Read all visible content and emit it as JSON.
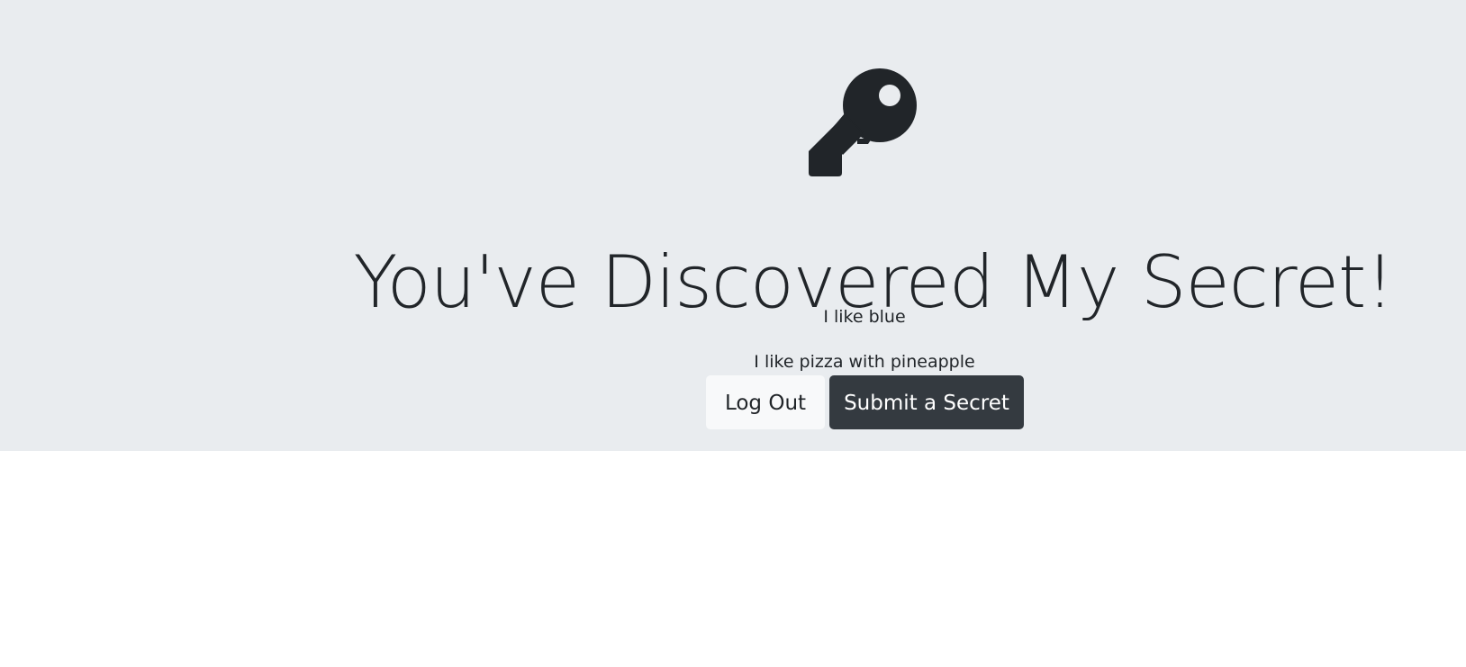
{
  "hero": {
    "icon": "key-icon",
    "title": "You've Discovered My Secret!"
  },
  "secrets": [
    "I like blue",
    "I like pizza with pineapple"
  ],
  "buttons": {
    "logout_label": "Log Out",
    "submit_label": "Submit a Secret"
  },
  "colors": {
    "jumbotron_bg": "#e9ecef",
    "text": "#212529",
    "button_light": "#f8f9fa",
    "button_dark": "#343a40"
  }
}
